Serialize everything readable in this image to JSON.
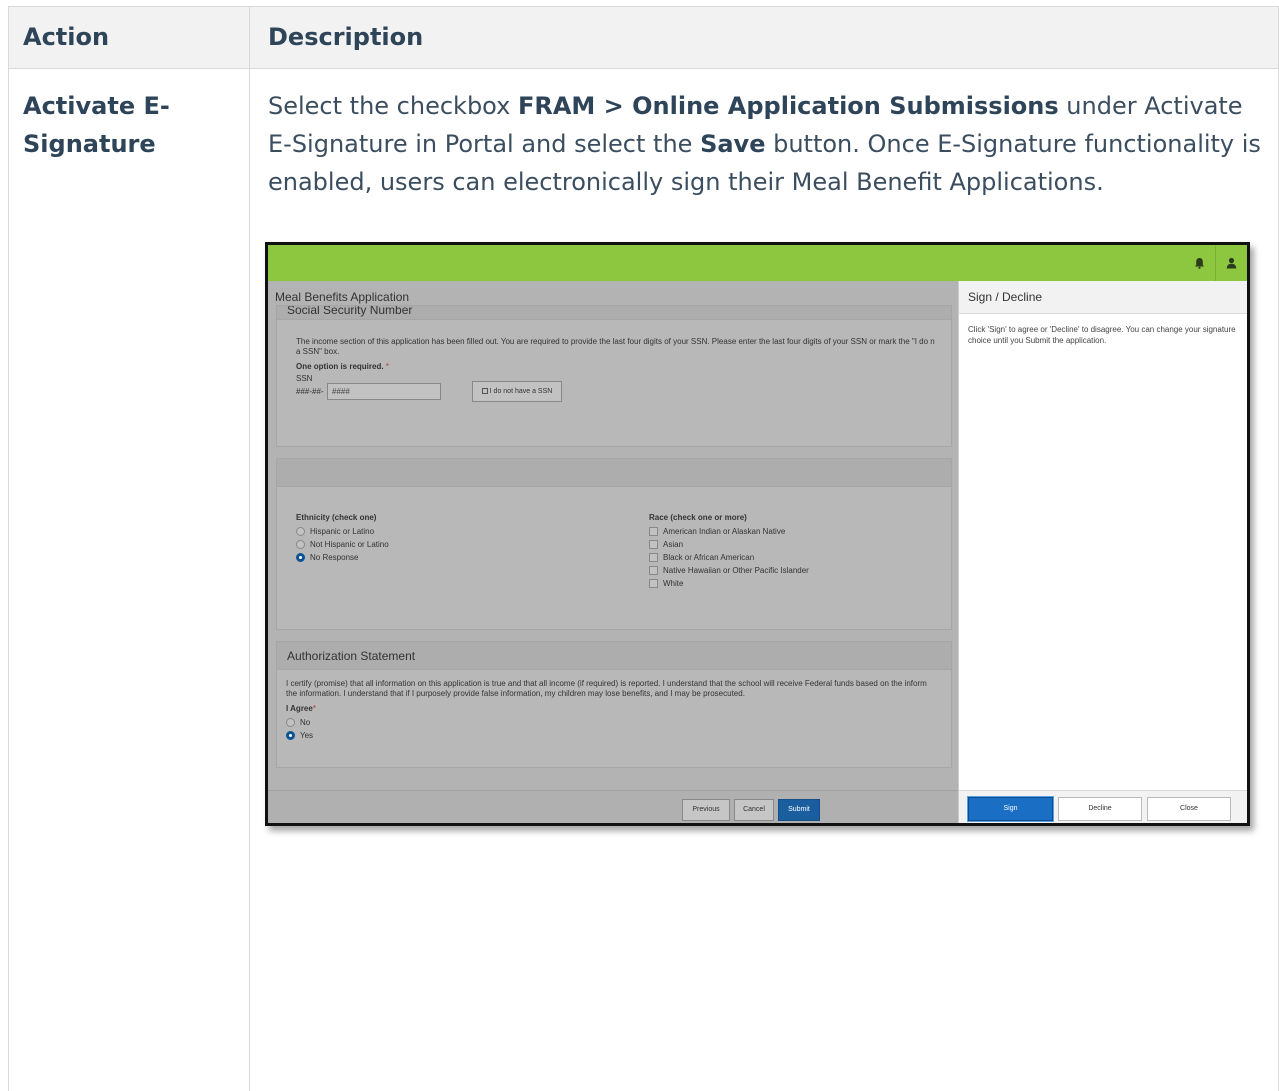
{
  "table": {
    "headers": {
      "action": "Action",
      "description": "Description"
    },
    "row": {
      "action": "Activate E-Signature",
      "desc_1": "Select the checkbox ",
      "desc_bold_1": "FRAM > Online Application Submissions",
      "desc_2": " under Activate E-Signature in Portal and select the ",
      "desc_bold_2": "Save",
      "desc_3": " button. Once E-Signature functionality is enabled, users can electronically sign their Meal Benefit Applications."
    }
  },
  "screenshot": {
    "topbar": {
      "color": "#8dc63f",
      "icons": [
        "bell-icon",
        "user-icon"
      ]
    },
    "main": {
      "title": "Meal Benefits Application",
      "ssn": {
        "heading": "Social Security Number",
        "intro": "The income section of this application has been filled out. You are required to provide the last four digits of your SSN. Please enter the last four digits of your SSN or mark the \"I do n",
        "intro2": "a SSN\" box.",
        "required": "One option is required.",
        "required_mark": "*",
        "label": "SSN",
        "prefix": "###-##-",
        "placeholder": "####",
        "no_ssn": "I do not have a SSN"
      },
      "ethnicity": {
        "label": "Ethnicity (check one)",
        "options": [
          {
            "label": "Hispanic or Latino",
            "selected": false
          },
          {
            "label": "Not Hispanic or Latino",
            "selected": false
          },
          {
            "label": "No Response",
            "selected": true
          }
        ]
      },
      "race": {
        "label": "Race (check one or more)",
        "options": [
          "American Indian or Alaskan Native",
          "Asian",
          "Black or African American",
          "Native Hawaiian or Other Pacific Islander",
          "White"
        ]
      },
      "authorization": {
        "heading": "Authorization Statement",
        "text1": "I certify (promise) that all information on this application is true and that all income (if required) is reported. I understand that the school will receive Federal funds based on the inform",
        "text2": "the information. I understand that if I purposely provide false information, my children may lose benefits, and I may be prosecuted.",
        "agree_label": "I Agree",
        "agree_mark": "*",
        "options": [
          {
            "label": "No",
            "selected": false
          },
          {
            "label": "Yes",
            "selected": true
          }
        ]
      },
      "footer": {
        "previous": "Previous",
        "cancel": "Cancel",
        "submit": "Submit"
      }
    },
    "side": {
      "title": "Sign / Decline",
      "text": "Click 'Sign' to agree or 'Decline' to disagree. You can change your signature choice until you Submit the application.",
      "buttons": {
        "sign": "Sign",
        "decline": "Decline",
        "close": "Close"
      }
    }
  }
}
